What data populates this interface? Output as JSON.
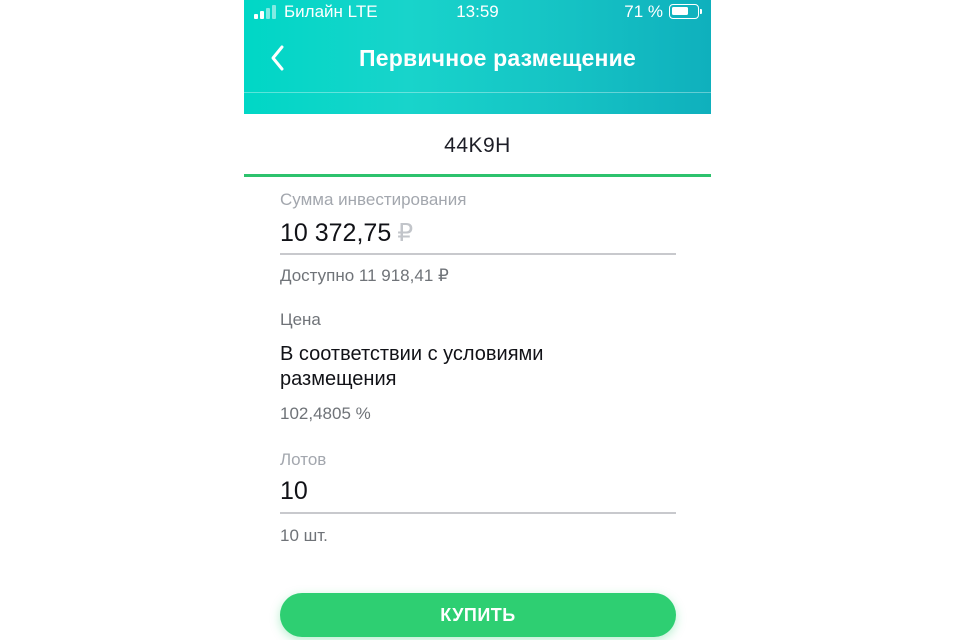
{
  "status_bar": {
    "carrier": "Билайн LTE",
    "time": "13:59",
    "battery_percent": "71 %",
    "battery_level": 0.71
  },
  "header": {
    "title": "Первичное размещение",
    "back_icon": "chevron-left-icon"
  },
  "tab": {
    "label": "44K9H"
  },
  "investment": {
    "label": "Сумма инвестирования",
    "value": "10 372,75",
    "currency": "₽",
    "available": "Доступно 11 918,41 ₽"
  },
  "price": {
    "label": "Цена",
    "value": "В соответствии с условиями размещения",
    "percent": "102,4805 %"
  },
  "lots": {
    "label": "Лотов",
    "value": "10",
    "helper": "10 шт."
  },
  "buy_button": {
    "label": "КУПИТЬ"
  },
  "colors": {
    "accent": "#2ecf72",
    "header_start": "#00d7c6",
    "header_end": "#0fb0bd"
  }
}
